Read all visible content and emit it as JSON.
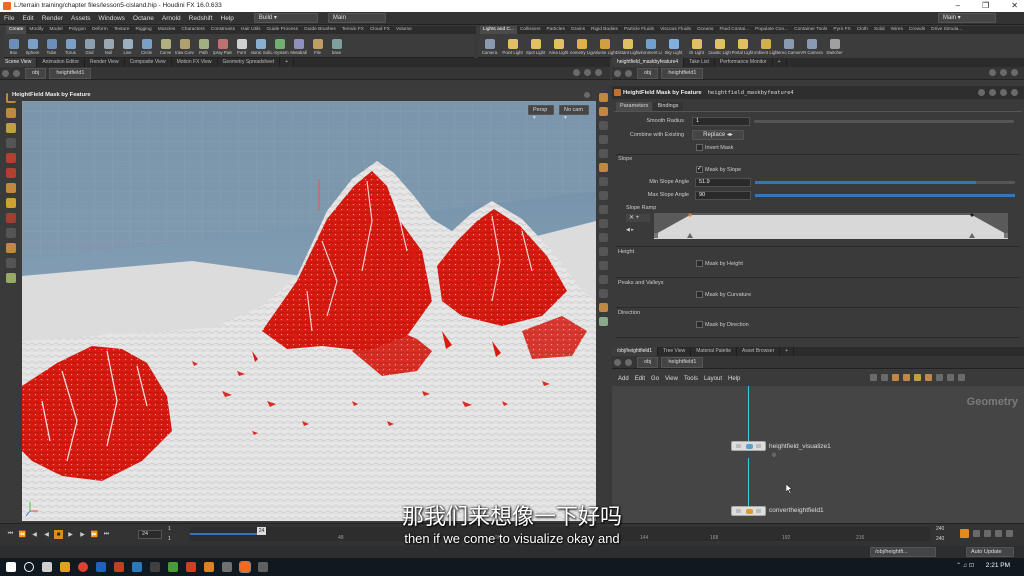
{
  "titlebar": {
    "title": "L:/terrain training/chapter files/lesson5-cisland.hip - Houdini FX 16.0.633",
    "minimize": "–",
    "maximize": "❐",
    "close": "✕"
  },
  "menu": {
    "items": [
      "File",
      "Edit",
      "Render",
      "Assets",
      "Windows",
      "Octane",
      "Arnold",
      "Redshift",
      "Help"
    ],
    "desktop": "Build",
    "main": "Main",
    "right_main": "Main"
  },
  "shelf_tabs_left": [
    "Create",
    "Modify",
    "Model",
    "Polygon",
    "Deform",
    "Texture",
    "Rigging",
    "Muscles",
    "Characters",
    "Constraints",
    "Hair Utils",
    "Guide Process",
    "Guide Brushes",
    "Terrain FX",
    "Cloud FX",
    "Volume"
  ],
  "shelf_tabs_right": [
    "Lights and C...",
    "Collisions",
    "Particles",
    "Grains",
    "Rigid Bodies",
    "Particle Fluids",
    "Viscous Fluids",
    "Oceans",
    "Fluid Contai...",
    "Populate Con...",
    "Container Tools",
    "Pyro FX",
    "Cloth",
    "Solid",
    "Wires",
    "Crowds",
    "Drive Simula..."
  ],
  "shelf_tools_left": [
    {
      "label": "Box",
      "color": "#6b8fb8"
    },
    {
      "label": "Sphere",
      "color": "#7aa0c8"
    },
    {
      "label": "Tube",
      "color": "#6b8fb8"
    },
    {
      "label": "Torus",
      "color": "#7aa0c8"
    },
    {
      "label": "Grid",
      "color": "#8aa0b0"
    },
    {
      "label": "Null",
      "color": "#9aa8b4"
    },
    {
      "label": "Line",
      "color": "#9ab0c0"
    },
    {
      "label": "Circle",
      "color": "#7aa0c8"
    },
    {
      "label": "Curve",
      "color": "#b0b080"
    },
    {
      "label": "Draw Curve",
      "color": "#b0a070"
    },
    {
      "label": "Path",
      "color": "#a0b080"
    },
    {
      "label": "Spray Paint",
      "color": "#c07070"
    },
    {
      "label": "Font",
      "color": "#d0d0d0"
    },
    {
      "label": "Platonic Solids",
      "color": "#8ab0d0"
    },
    {
      "label": "L-System",
      "color": "#70b070"
    },
    {
      "label": "Metaball",
      "color": "#9090c0"
    },
    {
      "label": "File",
      "color": "#c0a060"
    },
    {
      "label": "base",
      "color": "#80a0a0"
    }
  ],
  "shelf_tools_right": [
    {
      "label": "Camera",
      "color": "#8a9ab0"
    },
    {
      "label": "Point Light",
      "color": "#e0c060"
    },
    {
      "label": "Spot Light",
      "color": "#e0c060"
    },
    {
      "label": "Area Light",
      "color": "#e0c060"
    },
    {
      "label": "Geometry Light",
      "color": "#e0b050"
    },
    {
      "label": "Volume Light",
      "color": "#d0a040"
    },
    {
      "label": "Distant Light",
      "color": "#e0c060"
    },
    {
      "label": "Environment Light",
      "color": "#70a0d0"
    },
    {
      "label": "Sky Light",
      "color": "#80b0e0"
    },
    {
      "label": "GI Light",
      "color": "#e0c060"
    },
    {
      "label": "Caustic Light",
      "color": "#e0c060"
    },
    {
      "label": "Portal Light",
      "color": "#e0c060"
    },
    {
      "label": "Ambient Light",
      "color": "#d0b050"
    },
    {
      "label": "Stereo Camera",
      "color": "#8a9ab0"
    },
    {
      "label": "VR Camera",
      "color": "#8a9ab0"
    },
    {
      "label": "Switcher",
      "color": "#a0a0a0"
    }
  ],
  "left_pane_tabs": [
    "Scene View",
    "Animation Editor",
    "Render View",
    "Composite View",
    "Motion FX View",
    "Geometry Spreadsheet"
  ],
  "left_path": {
    "root": "obj",
    "node": "heightfield1"
  },
  "viewport": {
    "header": "HeightField Mask by Feature",
    "persp": "Persp ▾",
    "cam": "No cam ▾"
  },
  "param_tabs": [
    "heightfield_maskbyfeature4",
    "Take List",
    "Performance Monitor"
  ],
  "param_path": {
    "root": "obj",
    "node": "heightfield1"
  },
  "params": {
    "node_type": "HeightField Mask by Feature",
    "node_name": "heightfield_maskbyfeature4",
    "tabs": [
      "Parameters",
      "Bindings"
    ],
    "smooth_radius_label": "Smooth Radius",
    "smooth_radius": "1",
    "combine_label": "Combine with Existing",
    "combine": "Replace",
    "invert_mask": "Invert Mask",
    "slope_section": "Slope",
    "mask_by_slope": "Mask by Slope",
    "min_slope_label": "Min Slope Angle",
    "min_slope": "51.9",
    "min_slope_level": 0.85,
    "max_slope_label": "Max Slope Angle",
    "max_slope": "90",
    "max_slope_level": 1.0,
    "slope_ramp": "Slope Ramp",
    "height_section": "Height",
    "mask_by_height": "Mask by Height",
    "peaks_section": "Peaks and Valleys",
    "mask_by_curvature": "Mask by Curvature",
    "direction_section": "Direction",
    "mask_by_direction": "Mask by Direction"
  },
  "net_tabs": [
    "/obj/heightfield1",
    "Tree View",
    "Material Palette",
    "Asset Browser"
  ],
  "net_path": {
    "root": "obj",
    "node": "heightfield1"
  },
  "net_menu": [
    "Add",
    "Edit",
    "Go",
    "View",
    "Tools",
    "Layout",
    "Help"
  ],
  "network": {
    "context_label": "Geometry",
    "node1": "heightfield_visualize1",
    "node2": "convertheightfield1"
  },
  "timeline": {
    "current_frame": "24",
    "frame_marker": "24",
    "start": "1",
    "start2": "1",
    "ticks": [
      "48",
      "96",
      "144",
      "168",
      "192",
      "216"
    ],
    "end": "240",
    "end2": "240",
    "playhead_fraction": 0.096
  },
  "status": {
    "path": "/obj/heightfi...",
    "auto_update": "Auto Update"
  },
  "taskbar": {
    "time": "2:21 PM"
  },
  "subtitles": {
    "zh": "那我们来想像一下好吗",
    "en": "then if we come to visualize okay and"
  },
  "colors": {
    "mask_red": "#d91a10",
    "terrain": "#e8e8e8",
    "houdini_orange": "#f26b1d"
  }
}
